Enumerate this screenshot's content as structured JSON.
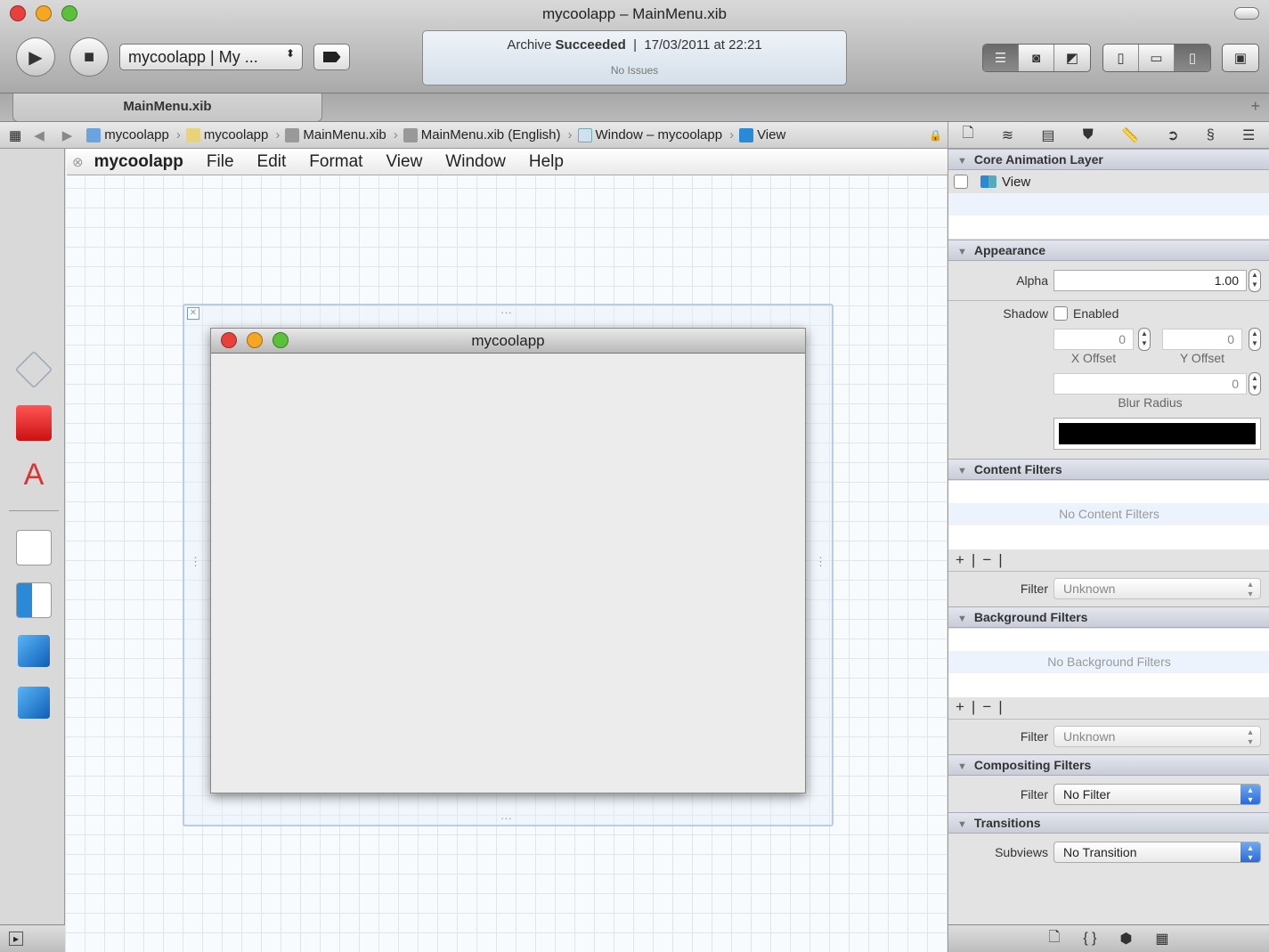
{
  "window": {
    "title": "mycoolapp – MainMenu.xib"
  },
  "toolbar": {
    "run_icon": "play-icon",
    "stop_icon": "stop-icon",
    "scheme": "mycoolapp | My ...",
    "breakpoints_icon": "breakpoint-icon"
  },
  "activity": {
    "status_prefix": "Archive",
    "status_bold": "Succeeded",
    "date": "17/03/2011 at 22:21",
    "issues": "No Issues"
  },
  "editor_tabs": [
    {
      "label": "MainMenu.xib"
    }
  ],
  "jumpbar": [
    "mycoolapp",
    "mycoolapp",
    "MainMenu.xib",
    "MainMenu.xib (English)",
    "Window – mycoolapp",
    "View"
  ],
  "menu_mock": {
    "app": "mycoolapp",
    "items": [
      "File",
      "Edit",
      "Format",
      "View",
      "Window",
      "Help"
    ]
  },
  "design_window": {
    "title": "mycoolapp"
  },
  "inspector": {
    "core_animation": {
      "header": "Core Animation Layer",
      "layer_item": "View"
    },
    "appearance": {
      "header": "Appearance",
      "alpha_label": "Alpha",
      "alpha": "1.00",
      "shadow_label": "Shadow",
      "enabled_label": "Enabled",
      "x_offset": "0",
      "y_offset": "0",
      "x_label": "X Offset",
      "y_label": "Y Offset",
      "blur": "0",
      "blur_label": "Blur Radius",
      "shadow_color": "#000000"
    },
    "content_filters": {
      "header": "Content Filters",
      "empty": "No Content Filters",
      "filter_label": "Filter",
      "filter": "Unknown"
    },
    "background_filters": {
      "header": "Background Filters",
      "empty": "No Background Filters",
      "filter_label": "Filter",
      "filter": "Unknown"
    },
    "compositing": {
      "header": "Compositing Filters",
      "filter_label": "Filter",
      "filter": "No Filter"
    },
    "transitions": {
      "header": "Transitions",
      "subviews_label": "Subviews",
      "subviews": "No Transition"
    }
  },
  "colors": {
    "accent": "#2a6bd8",
    "grid": "#d6e8f3"
  }
}
